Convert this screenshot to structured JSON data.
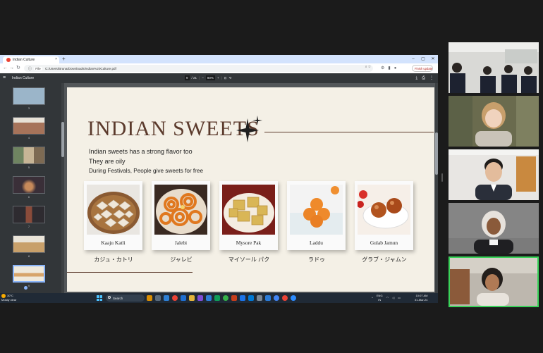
{
  "browser": {
    "tab_title": "Indian Culture",
    "new_tab": "+",
    "close": "×",
    "window_controls": [
      "–",
      "▢",
      "✕"
    ],
    "file_chip": "File",
    "address": "C:/Users/Bruna/Downloads/Indian%20Culture.pdf",
    "update_label": "Finish update"
  },
  "pdf_viewer": {
    "doc_title": "Indian Culture",
    "page_current": "9",
    "page_total": "/ 21",
    "zoom": "80%",
    "zoom_minus": "−",
    "zoom_plus": "+",
    "thumbnails": [
      {
        "num": "3",
        "color": "#9bb5c9"
      },
      {
        "num": "4",
        "color": "#a6735a"
      },
      {
        "num": "5",
        "color": "#6f8461"
      },
      {
        "num": "6",
        "color": "#3a2f38"
      },
      {
        "num": "7",
        "color": "#2e2b30"
      },
      {
        "num": "8",
        "color": "#c8b497"
      },
      {
        "num": "9",
        "color": "#efe9dc"
      }
    ]
  },
  "slide": {
    "title": "INDIAN SWEETS",
    "lines": [
      "Indian sweets has a strong flavor too",
      "They are oily",
      "During Festivals, People give sweets for free"
    ],
    "sweets": [
      {
        "name": "Kaaju Katli",
        "jp": "カジュ・カトリ"
      },
      {
        "name": "Jalebi",
        "jp": "ジャレビ"
      },
      {
        "name": "Mysore Pak",
        "jp": "マイソール パク"
      },
      {
        "name": "Laddu",
        "jp": "ラドゥ"
      },
      {
        "name": "Gulab Jamun",
        "jp": "グラブ・ジャムン"
      }
    ]
  },
  "taskbar": {
    "weather_temp": "30°C",
    "weather_desc": "Mostly clear",
    "search_placeholder": "Search",
    "lang_top": "ENG",
    "lang_bottom": "IN",
    "time": "10:07 AM",
    "date": "31-Mar-24"
  },
  "colors": {
    "slide_bg": "#f4f0e6",
    "title_brown": "#5b3a2c",
    "speaking_border": "#3ad35a"
  }
}
